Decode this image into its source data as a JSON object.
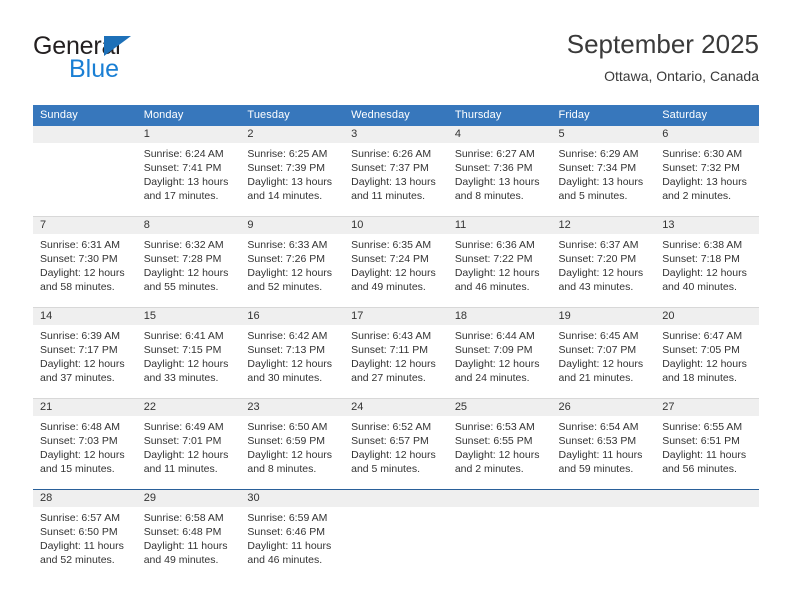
{
  "brand": {
    "name_top": "General",
    "name_bottom": "Blue",
    "triangle_color": "#1d70b8",
    "blue_color": "#1a7fd4"
  },
  "header": {
    "month_title": "September 2025",
    "location": "Ottawa, Ontario, Canada"
  },
  "theme": {
    "header_bg": "#3777bc",
    "daynum_bg": "#efefef",
    "row_separator": "#d8d8d8",
    "last_row_separator": "#2a6099"
  },
  "weekdays": [
    "Sunday",
    "Monday",
    "Tuesday",
    "Wednesday",
    "Thursday",
    "Friday",
    "Saturday"
  ],
  "weeks": [
    [
      {
        "day": "",
        "empty": true
      },
      {
        "day": "1",
        "sunrise": "Sunrise: 6:24 AM",
        "sunset": "Sunset: 7:41 PM",
        "daylight1": "Daylight: 13 hours",
        "daylight2": "and 17 minutes."
      },
      {
        "day": "2",
        "sunrise": "Sunrise: 6:25 AM",
        "sunset": "Sunset: 7:39 PM",
        "daylight1": "Daylight: 13 hours",
        "daylight2": "and 14 minutes."
      },
      {
        "day": "3",
        "sunrise": "Sunrise: 6:26 AM",
        "sunset": "Sunset: 7:37 PM",
        "daylight1": "Daylight: 13 hours",
        "daylight2": "and 11 minutes."
      },
      {
        "day": "4",
        "sunrise": "Sunrise: 6:27 AM",
        "sunset": "Sunset: 7:36 PM",
        "daylight1": "Daylight: 13 hours",
        "daylight2": "and 8 minutes."
      },
      {
        "day": "5",
        "sunrise": "Sunrise: 6:29 AM",
        "sunset": "Sunset: 7:34 PM",
        "daylight1": "Daylight: 13 hours",
        "daylight2": "and 5 minutes."
      },
      {
        "day": "6",
        "sunrise": "Sunrise: 6:30 AM",
        "sunset": "Sunset: 7:32 PM",
        "daylight1": "Daylight: 13 hours",
        "daylight2": "and 2 minutes."
      }
    ],
    [
      {
        "day": "7",
        "sunrise": "Sunrise: 6:31 AM",
        "sunset": "Sunset: 7:30 PM",
        "daylight1": "Daylight: 12 hours",
        "daylight2": "and 58 minutes."
      },
      {
        "day": "8",
        "sunrise": "Sunrise: 6:32 AM",
        "sunset": "Sunset: 7:28 PM",
        "daylight1": "Daylight: 12 hours",
        "daylight2": "and 55 minutes."
      },
      {
        "day": "9",
        "sunrise": "Sunrise: 6:33 AM",
        "sunset": "Sunset: 7:26 PM",
        "daylight1": "Daylight: 12 hours",
        "daylight2": "and 52 minutes."
      },
      {
        "day": "10",
        "sunrise": "Sunrise: 6:35 AM",
        "sunset": "Sunset: 7:24 PM",
        "daylight1": "Daylight: 12 hours",
        "daylight2": "and 49 minutes."
      },
      {
        "day": "11",
        "sunrise": "Sunrise: 6:36 AM",
        "sunset": "Sunset: 7:22 PM",
        "daylight1": "Daylight: 12 hours",
        "daylight2": "and 46 minutes."
      },
      {
        "day": "12",
        "sunrise": "Sunrise: 6:37 AM",
        "sunset": "Sunset: 7:20 PM",
        "daylight1": "Daylight: 12 hours",
        "daylight2": "and 43 minutes."
      },
      {
        "day": "13",
        "sunrise": "Sunrise: 6:38 AM",
        "sunset": "Sunset: 7:18 PM",
        "daylight1": "Daylight: 12 hours",
        "daylight2": "and 40 minutes."
      }
    ],
    [
      {
        "day": "14",
        "sunrise": "Sunrise: 6:39 AM",
        "sunset": "Sunset: 7:17 PM",
        "daylight1": "Daylight: 12 hours",
        "daylight2": "and 37 minutes."
      },
      {
        "day": "15",
        "sunrise": "Sunrise: 6:41 AM",
        "sunset": "Sunset: 7:15 PM",
        "daylight1": "Daylight: 12 hours",
        "daylight2": "and 33 minutes."
      },
      {
        "day": "16",
        "sunrise": "Sunrise: 6:42 AM",
        "sunset": "Sunset: 7:13 PM",
        "daylight1": "Daylight: 12 hours",
        "daylight2": "and 30 minutes."
      },
      {
        "day": "17",
        "sunrise": "Sunrise: 6:43 AM",
        "sunset": "Sunset: 7:11 PM",
        "daylight1": "Daylight: 12 hours",
        "daylight2": "and 27 minutes."
      },
      {
        "day": "18",
        "sunrise": "Sunrise: 6:44 AM",
        "sunset": "Sunset: 7:09 PM",
        "daylight1": "Daylight: 12 hours",
        "daylight2": "and 24 minutes."
      },
      {
        "day": "19",
        "sunrise": "Sunrise: 6:45 AM",
        "sunset": "Sunset: 7:07 PM",
        "daylight1": "Daylight: 12 hours",
        "daylight2": "and 21 minutes."
      },
      {
        "day": "20",
        "sunrise": "Sunrise: 6:47 AM",
        "sunset": "Sunset: 7:05 PM",
        "daylight1": "Daylight: 12 hours",
        "daylight2": "and 18 minutes."
      }
    ],
    [
      {
        "day": "21",
        "sunrise": "Sunrise: 6:48 AM",
        "sunset": "Sunset: 7:03 PM",
        "daylight1": "Daylight: 12 hours",
        "daylight2": "and 15 minutes."
      },
      {
        "day": "22",
        "sunrise": "Sunrise: 6:49 AM",
        "sunset": "Sunset: 7:01 PM",
        "daylight1": "Daylight: 12 hours",
        "daylight2": "and 11 minutes."
      },
      {
        "day": "23",
        "sunrise": "Sunrise: 6:50 AM",
        "sunset": "Sunset: 6:59 PM",
        "daylight1": "Daylight: 12 hours",
        "daylight2": "and 8 minutes."
      },
      {
        "day": "24",
        "sunrise": "Sunrise: 6:52 AM",
        "sunset": "Sunset: 6:57 PM",
        "daylight1": "Daylight: 12 hours",
        "daylight2": "and 5 minutes."
      },
      {
        "day": "25",
        "sunrise": "Sunrise: 6:53 AM",
        "sunset": "Sunset: 6:55 PM",
        "daylight1": "Daylight: 12 hours",
        "daylight2": "and 2 minutes."
      },
      {
        "day": "26",
        "sunrise": "Sunrise: 6:54 AM",
        "sunset": "Sunset: 6:53 PM",
        "daylight1": "Daylight: 11 hours",
        "daylight2": "and 59 minutes."
      },
      {
        "day": "27",
        "sunrise": "Sunrise: 6:55 AM",
        "sunset": "Sunset: 6:51 PM",
        "daylight1": "Daylight: 11 hours",
        "daylight2": "and 56 minutes."
      }
    ],
    [
      {
        "day": "28",
        "sunrise": "Sunrise: 6:57 AM",
        "sunset": "Sunset: 6:50 PM",
        "daylight1": "Daylight: 11 hours",
        "daylight2": "and 52 minutes."
      },
      {
        "day": "29",
        "sunrise": "Sunrise: 6:58 AM",
        "sunset": "Sunset: 6:48 PM",
        "daylight1": "Daylight: 11 hours",
        "daylight2": "and 49 minutes."
      },
      {
        "day": "30",
        "sunrise": "Sunrise: 6:59 AM",
        "sunset": "Sunset: 6:46 PM",
        "daylight1": "Daylight: 11 hours",
        "daylight2": "and 46 minutes."
      },
      {
        "day": "",
        "empty": true
      },
      {
        "day": "",
        "empty": true
      },
      {
        "day": "",
        "empty": true
      },
      {
        "day": "",
        "empty": true
      }
    ]
  ]
}
